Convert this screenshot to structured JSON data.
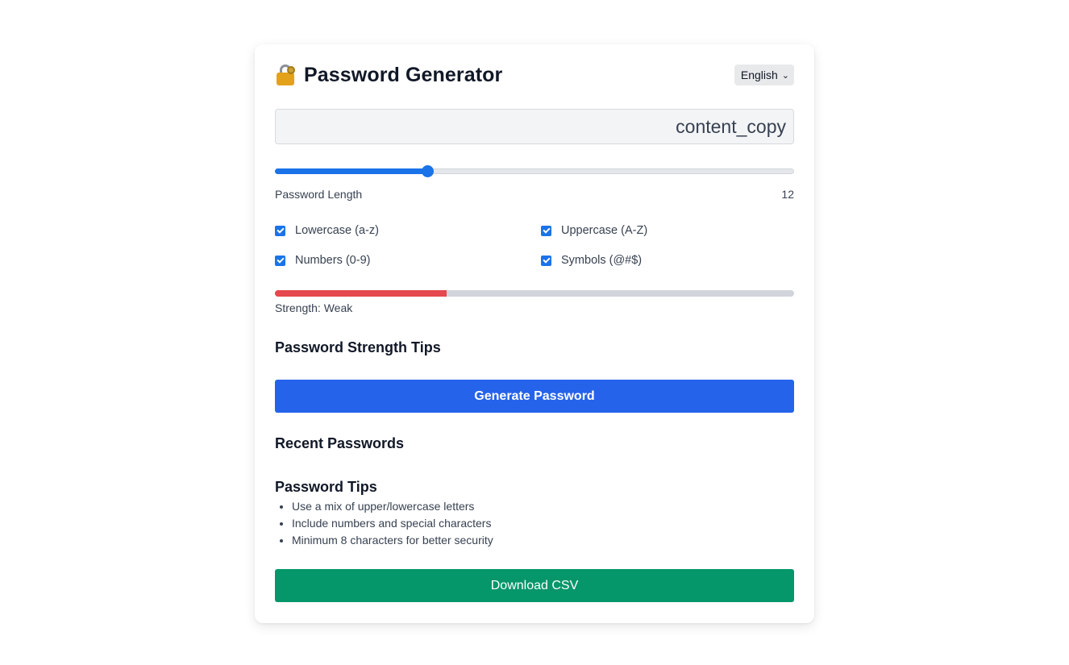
{
  "header": {
    "title": "Password Generator",
    "icon": "lock-with-key-icon",
    "language": "English"
  },
  "password_field": {
    "value": "",
    "copy_icon_label": "content_copy"
  },
  "length": {
    "label": "Password Length",
    "value": "12",
    "slider_fraction": 0.29
  },
  "options": [
    {
      "label": "Lowercase (a-z)",
      "checked": true
    },
    {
      "label": "Uppercase (A-Z)",
      "checked": true
    },
    {
      "label": "Numbers (0-9)",
      "checked": true
    },
    {
      "label": "Symbols (@#$)",
      "checked": true
    }
  ],
  "strength": {
    "text": "Strength: Weak",
    "fraction": 0.33,
    "color": "#e5484d"
  },
  "strength_tips_heading": "Password Strength Tips",
  "generate_button": "Generate Password",
  "recent_heading": "Recent Passwords",
  "tips": {
    "heading": "Password Tips",
    "items": [
      "Use a mix of upper/lowercase letters",
      "Include numbers and special characters",
      "Minimum 8 characters for better security"
    ]
  },
  "download_button": "Download CSV",
  "colors": {
    "accent": "#1a73e8",
    "primary_button": "#2563eb",
    "download_button": "#059669"
  }
}
